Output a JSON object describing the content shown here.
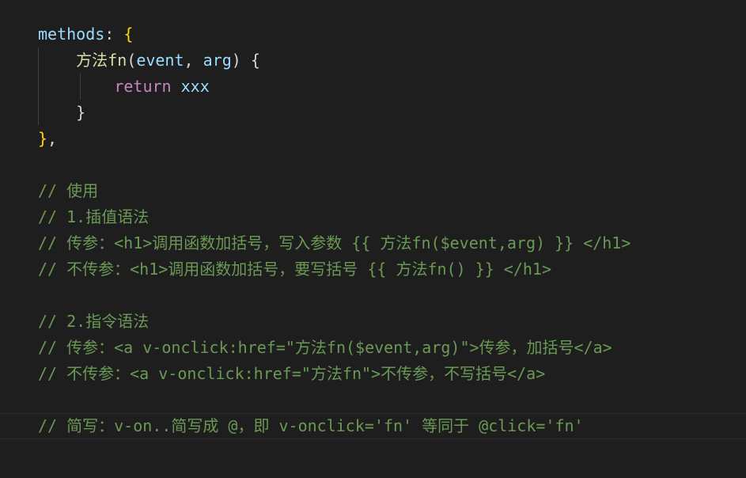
{
  "editor": {
    "lines": [
      {
        "id": "l1",
        "parts": [
          {
            "text": "methods",
            "kind": "kw-prop"
          },
          {
            "text": ": ",
            "kind": "punc"
          },
          {
            "text": "{",
            "kind": "brace"
          }
        ]
      },
      {
        "id": "l2",
        "parts": [
          {
            "text": "    ",
            "kind": "punc"
          },
          {
            "text": "方法fn",
            "kind": "fn"
          },
          {
            "text": "(",
            "kind": "punc"
          },
          {
            "text": "event",
            "kind": "param"
          },
          {
            "text": ", ",
            "kind": "punc"
          },
          {
            "text": "arg",
            "kind": "param"
          },
          {
            "text": ") {",
            "kind": "punc"
          }
        ]
      },
      {
        "id": "l3",
        "parts": [
          {
            "text": "        ",
            "kind": "punc"
          },
          {
            "text": "return",
            "kind": "ctrl"
          },
          {
            "text": " ",
            "kind": "punc"
          },
          {
            "text": "xxx",
            "kind": "var"
          }
        ]
      },
      {
        "id": "l4",
        "parts": [
          {
            "text": "    }",
            "kind": "punc"
          }
        ]
      },
      {
        "id": "l5",
        "parts": [
          {
            "text": "}",
            "kind": "brace"
          },
          {
            "text": ",",
            "kind": "punc"
          }
        ]
      },
      {
        "id": "l6",
        "parts": []
      },
      {
        "id": "l7",
        "parts": [
          {
            "text": "// 使用",
            "kind": "cmt"
          }
        ]
      },
      {
        "id": "l8",
        "parts": [
          {
            "text": "// 1.插值语法",
            "kind": "cmt"
          }
        ]
      },
      {
        "id": "l9",
        "parts": [
          {
            "text": "// 传参：<h1>调用函数加括号，写入参数 {{ 方法fn($event,arg) }} </h1>",
            "kind": "cmt"
          }
        ]
      },
      {
        "id": "l10",
        "parts": [
          {
            "text": "// 不传参：<h1>调用函数加括号，要写括号 {{ 方法fn() }} </h1>",
            "kind": "cmt"
          }
        ]
      },
      {
        "id": "l11",
        "parts": []
      },
      {
        "id": "l12",
        "parts": [
          {
            "text": "// 2.指令语法",
            "kind": "cmt"
          }
        ]
      },
      {
        "id": "l13",
        "parts": [
          {
            "text": "// 传参：<a v-onclick:href=\"方法fn($event,arg)\">传参，加括号</a>",
            "kind": "cmt"
          }
        ]
      },
      {
        "id": "l14",
        "parts": [
          {
            "text": "// 不传参：<a v-onclick:href=\"方法fn\">不传参，不写括号</a>",
            "kind": "cmt"
          }
        ]
      },
      {
        "id": "l15",
        "parts": []
      },
      {
        "id": "l16",
        "parts": [
          {
            "text": "// 简写：v-on..简写成 @，即 v-onclick='fn' 等同于 @click='fn'",
            "kind": "cmt"
          }
        ]
      }
    ]
  },
  "colors": {
    "background": "#1e1e1e",
    "property": "#9cdcfe",
    "function": "#dcdcaa",
    "keyword_control": "#c586c0",
    "comment": "#6a9955",
    "bracket": "#ffd700"
  }
}
